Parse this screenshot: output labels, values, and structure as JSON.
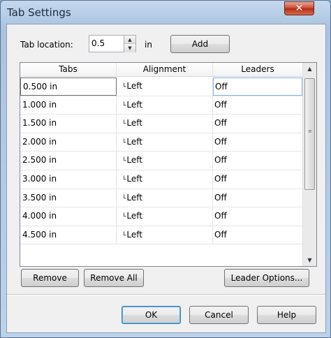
{
  "window": {
    "title": "Tab Settings",
    "close_glyph": "✕"
  },
  "tab_location": {
    "label": "Tab location:",
    "value": "0.5",
    "unit": "in",
    "add_label": "Add"
  },
  "grid": {
    "columns": [
      "Tabs",
      "Alignment",
      "Leaders"
    ],
    "rows": [
      {
        "tab": "0.500 in",
        "alignment": "Left",
        "leader": "Off"
      },
      {
        "tab": "1.000 in",
        "alignment": "Left",
        "leader": "Off"
      },
      {
        "tab": "1.500 in",
        "alignment": "Left",
        "leader": "Off"
      },
      {
        "tab": "2.000 in",
        "alignment": "Left",
        "leader": "Off"
      },
      {
        "tab": "2.500 in",
        "alignment": "Left",
        "leader": "Off"
      },
      {
        "tab": "3.000 in",
        "alignment": "Left",
        "leader": "Off"
      },
      {
        "tab": "3.500 in",
        "alignment": "Left",
        "leader": "Off"
      },
      {
        "tab": "4.000 in",
        "alignment": "Left",
        "leader": "Off"
      },
      {
        "tab": "4.500 in",
        "alignment": "Left",
        "leader": "Off"
      }
    ],
    "alignment_icon": "left-tab-icon"
  },
  "actions": {
    "remove": "Remove",
    "remove_all": "Remove All",
    "leader_options": "Leader Options..."
  },
  "footer": {
    "ok": "OK",
    "cancel": "Cancel",
    "help": "Help"
  },
  "colors": {
    "titlebar": "#a9c3e0",
    "close_button": "#c7432b",
    "selection_border": "#7eb4ea"
  }
}
